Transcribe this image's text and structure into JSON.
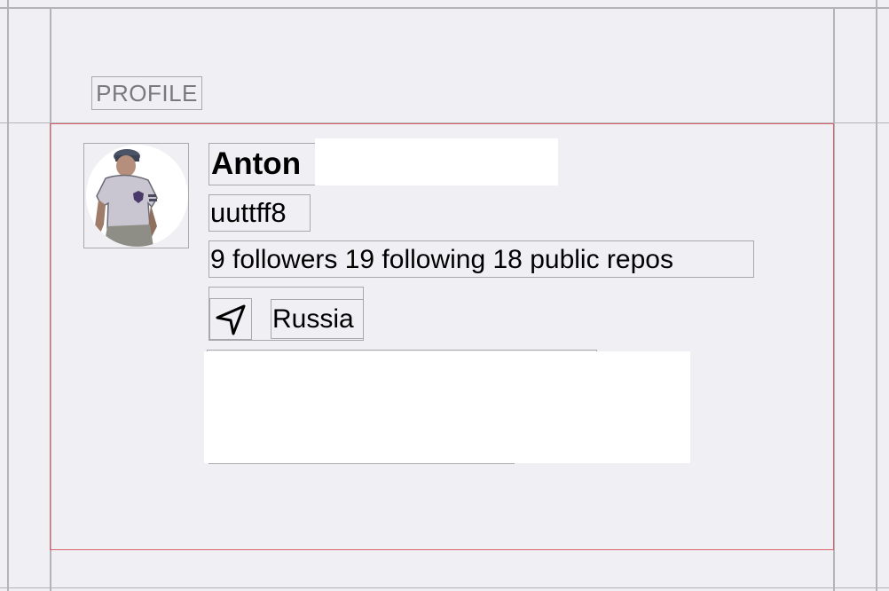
{
  "section": {
    "title": "PROFILE"
  },
  "profile": {
    "name": "Anton",
    "login": "uuttff8",
    "stats": "9 followers 19 following 18 public repos",
    "location": "Russia"
  },
  "icons": {
    "location": "location-arrow-icon"
  },
  "colors": {
    "background": "#efeff4",
    "card_border": "#d9616b",
    "outline": "#a9a9ad",
    "redaction": "#ffffff"
  }
}
